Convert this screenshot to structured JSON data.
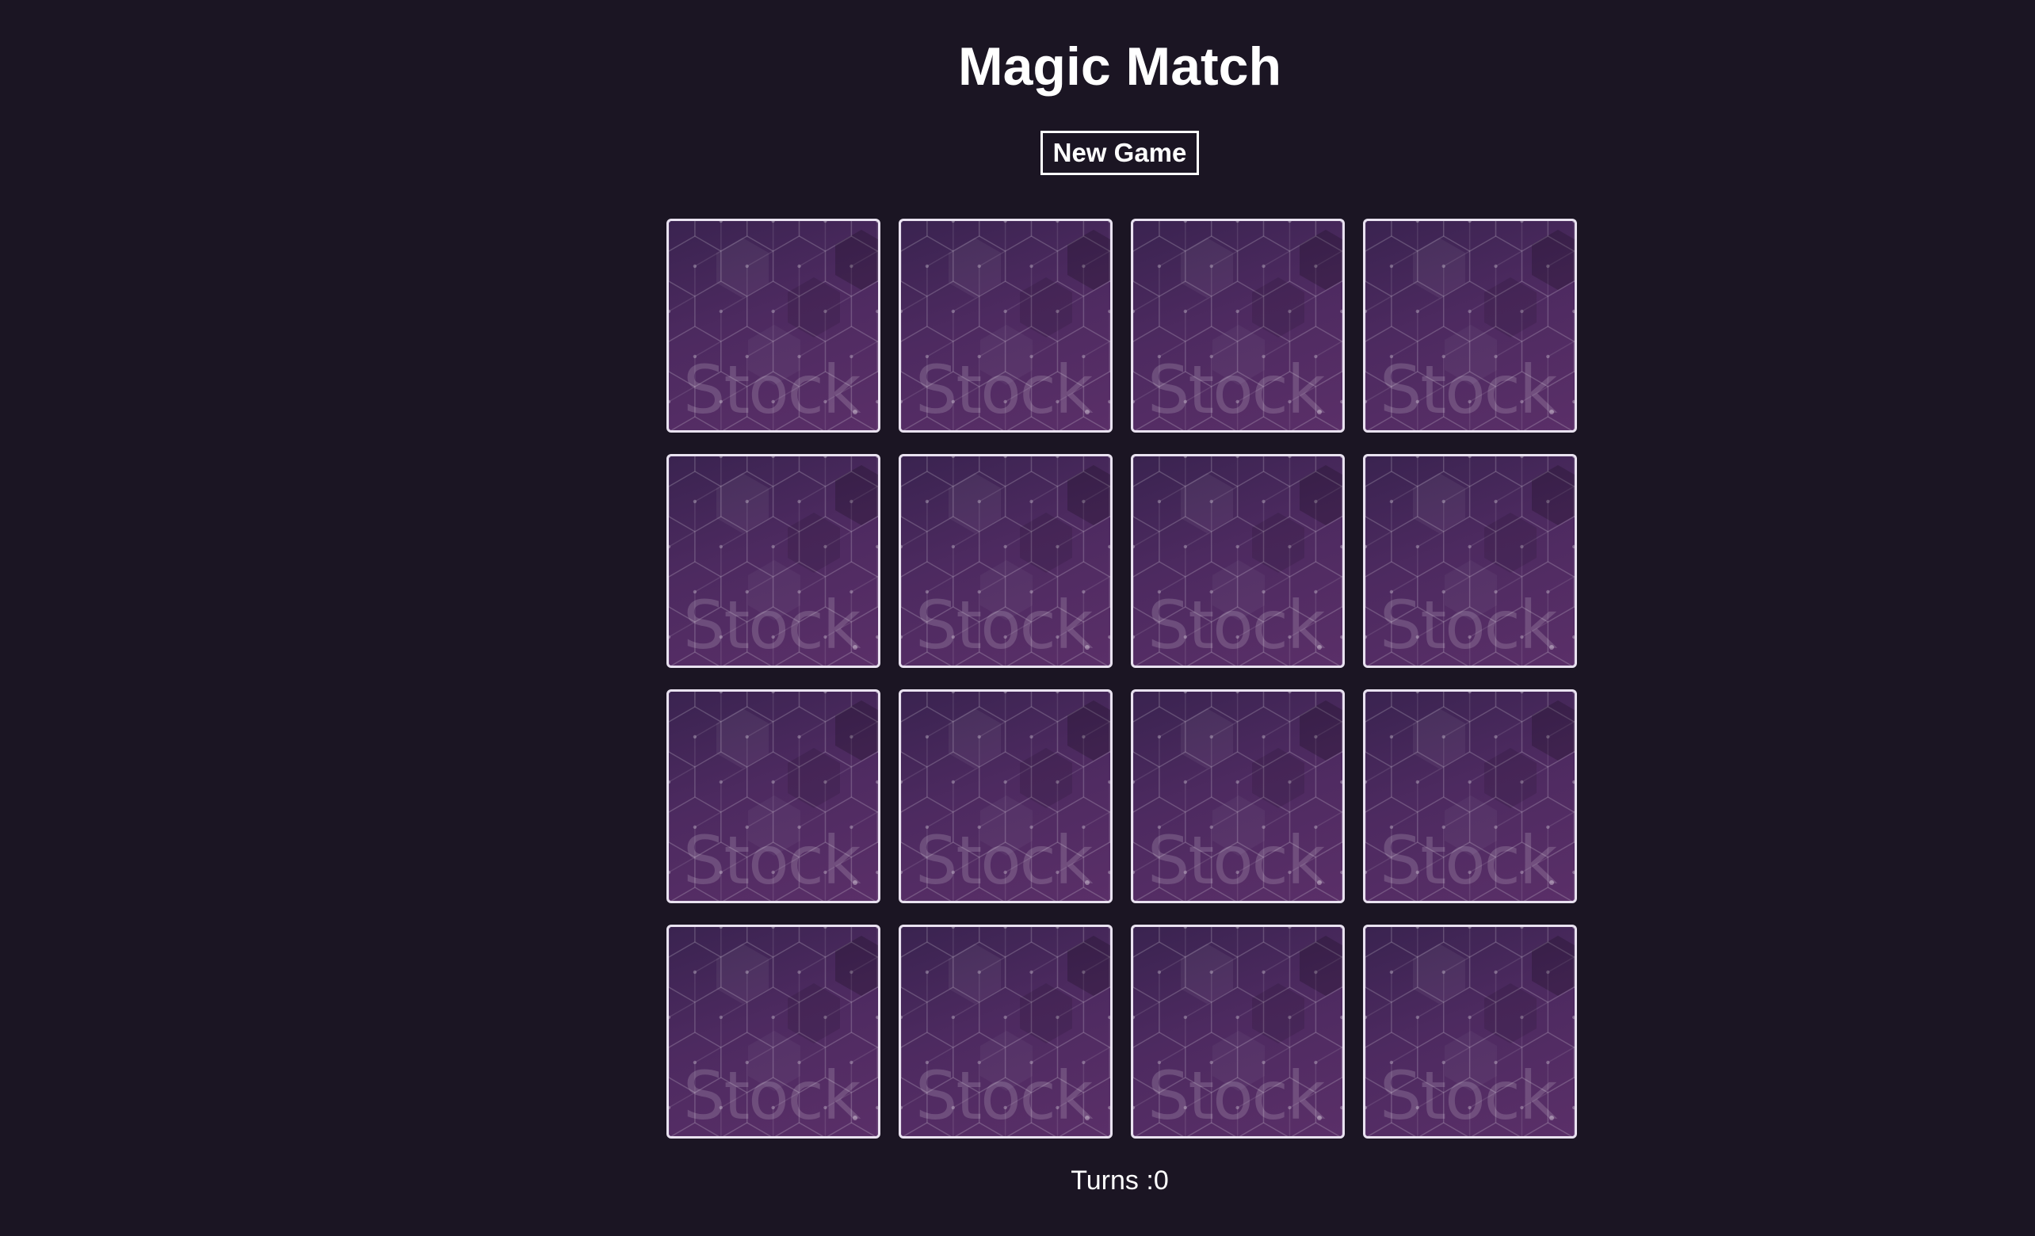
{
  "game": {
    "title": "Magic Match",
    "new_game_label": "New Game",
    "turns_label": "Turns :",
    "turns": 0
  },
  "cards": [
    {
      "state": "face-down",
      "watermark": "Stock"
    },
    {
      "state": "face-down",
      "watermark": "Stock"
    },
    {
      "state": "face-down",
      "watermark": "Stock"
    },
    {
      "state": "face-down",
      "watermark": "Stock"
    },
    {
      "state": "face-down",
      "watermark": "Stock"
    },
    {
      "state": "face-down",
      "watermark": "Stock"
    },
    {
      "state": "face-down",
      "watermark": "Stock"
    },
    {
      "state": "face-down",
      "watermark": "Stock"
    },
    {
      "state": "face-down",
      "watermark": "Stock"
    },
    {
      "state": "face-down",
      "watermark": "Stock"
    },
    {
      "state": "face-down",
      "watermark": "Stock"
    },
    {
      "state": "face-down",
      "watermark": "Stock"
    },
    {
      "state": "face-down",
      "watermark": "Stock"
    },
    {
      "state": "face-down",
      "watermark": "Stock"
    },
    {
      "state": "face-down",
      "watermark": "Stock"
    },
    {
      "state": "face-down",
      "watermark": "Stock"
    }
  ],
  "colors": {
    "background": "#1b1523",
    "card_border": "#e9e2f0",
    "card_back": "#4d2a60",
    "text": "#ffffff"
  }
}
